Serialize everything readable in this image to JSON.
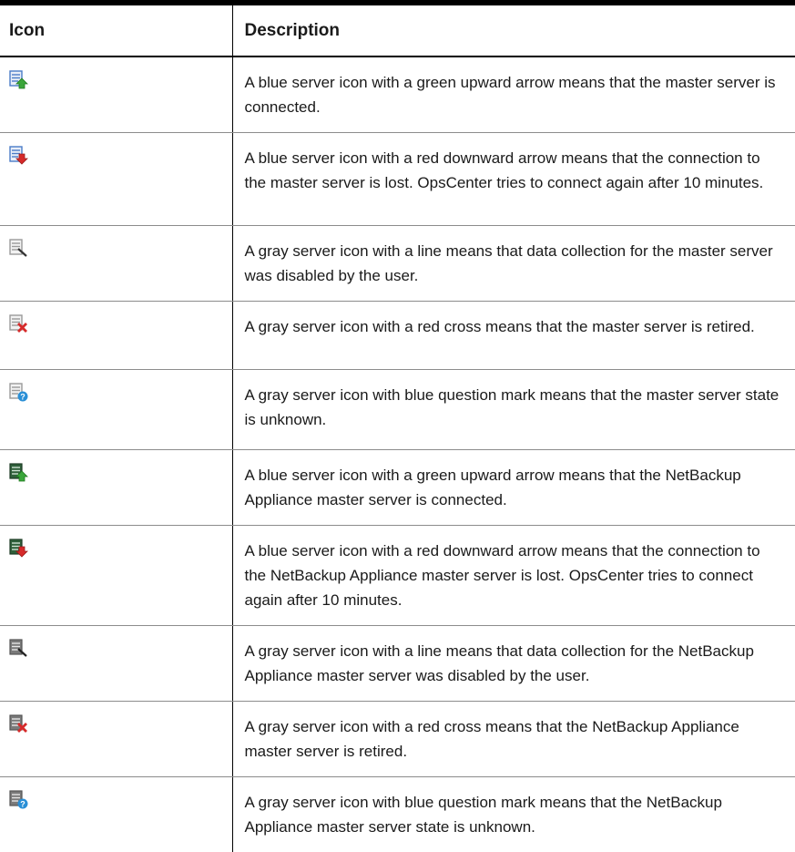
{
  "table": {
    "headers": {
      "icon": "Icon",
      "description": "Description"
    },
    "rows": [
      {
        "icon": "master-server-connected-icon",
        "description": "A blue server icon with a green upward arrow means that the master server is connected."
      },
      {
        "icon": "master-server-connection-lost-icon",
        "description": "A blue server icon with a red downward arrow means that the connection to the master server is lost. OpsCenter tries to connect again after 10 minutes."
      },
      {
        "icon": "master-server-disabled-icon",
        "description": "A gray server icon with a line means that data collection for the master server was disabled by the user."
      },
      {
        "icon": "master-server-retired-icon",
        "description": "A gray server icon with a red cross means that the master server is retired."
      },
      {
        "icon": "master-server-unknown-icon",
        "description": "A gray server icon with blue question mark means that the master server state is unknown."
      },
      {
        "icon": "appliance-server-connected-icon",
        "description": "A blue server icon with a green upward arrow means that the NetBackup Appliance master server is connected."
      },
      {
        "icon": "appliance-server-connection-lost-icon",
        "description": "A blue server icon with a red downward arrow means that the connection to the NetBackup Appliance master server is lost. OpsCenter tries to connect again after 10 minutes."
      },
      {
        "icon": "appliance-server-disabled-icon",
        "description": "A gray server icon with a line means that data collection for the NetBackup Appliance master server was disabled by the user."
      },
      {
        "icon": "appliance-server-retired-icon",
        "description": "A gray server icon with a red cross means that the NetBackup Appliance master server is retired."
      },
      {
        "icon": "appliance-server-unknown-icon",
        "description": "A gray server icon with blue question mark means that the NetBackup Appliance master server state is unknown."
      }
    ]
  },
  "colors": {
    "server_blue": "#4a7cc7",
    "server_gray": "#9a9a9a",
    "appliance_dark": "#2f5f3a",
    "arrow_green": "#3aa63a",
    "arrow_red": "#d62a2a",
    "question_blue": "#2a8fd6"
  }
}
